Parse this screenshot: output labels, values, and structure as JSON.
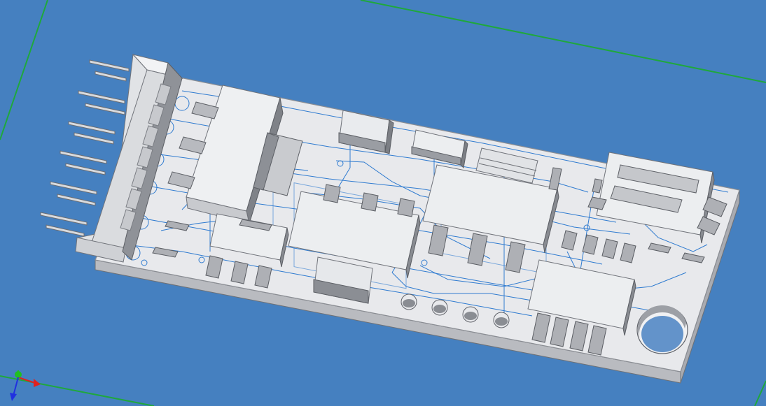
{
  "viewer": {
    "background_color": "#4580c0",
    "grid_line_color": "#1fa83c",
    "board_color": "#e8e9ec",
    "board_edge_color": "#8e9096",
    "trace_color": "#2f7bd0",
    "component_dark": "#7b7e86"
  },
  "triad": {
    "x_axis_color": "#e02020",
    "y_axis_color": "#20c020",
    "z_axis_color": "#2030e0",
    "icon": "axis-triad-icon"
  },
  "model": {
    "icon": "pcb-3d-model-icon",
    "connector_pin_count": 12,
    "through_hole_pad_count": 4,
    "mounting_hole_count": 1
  }
}
